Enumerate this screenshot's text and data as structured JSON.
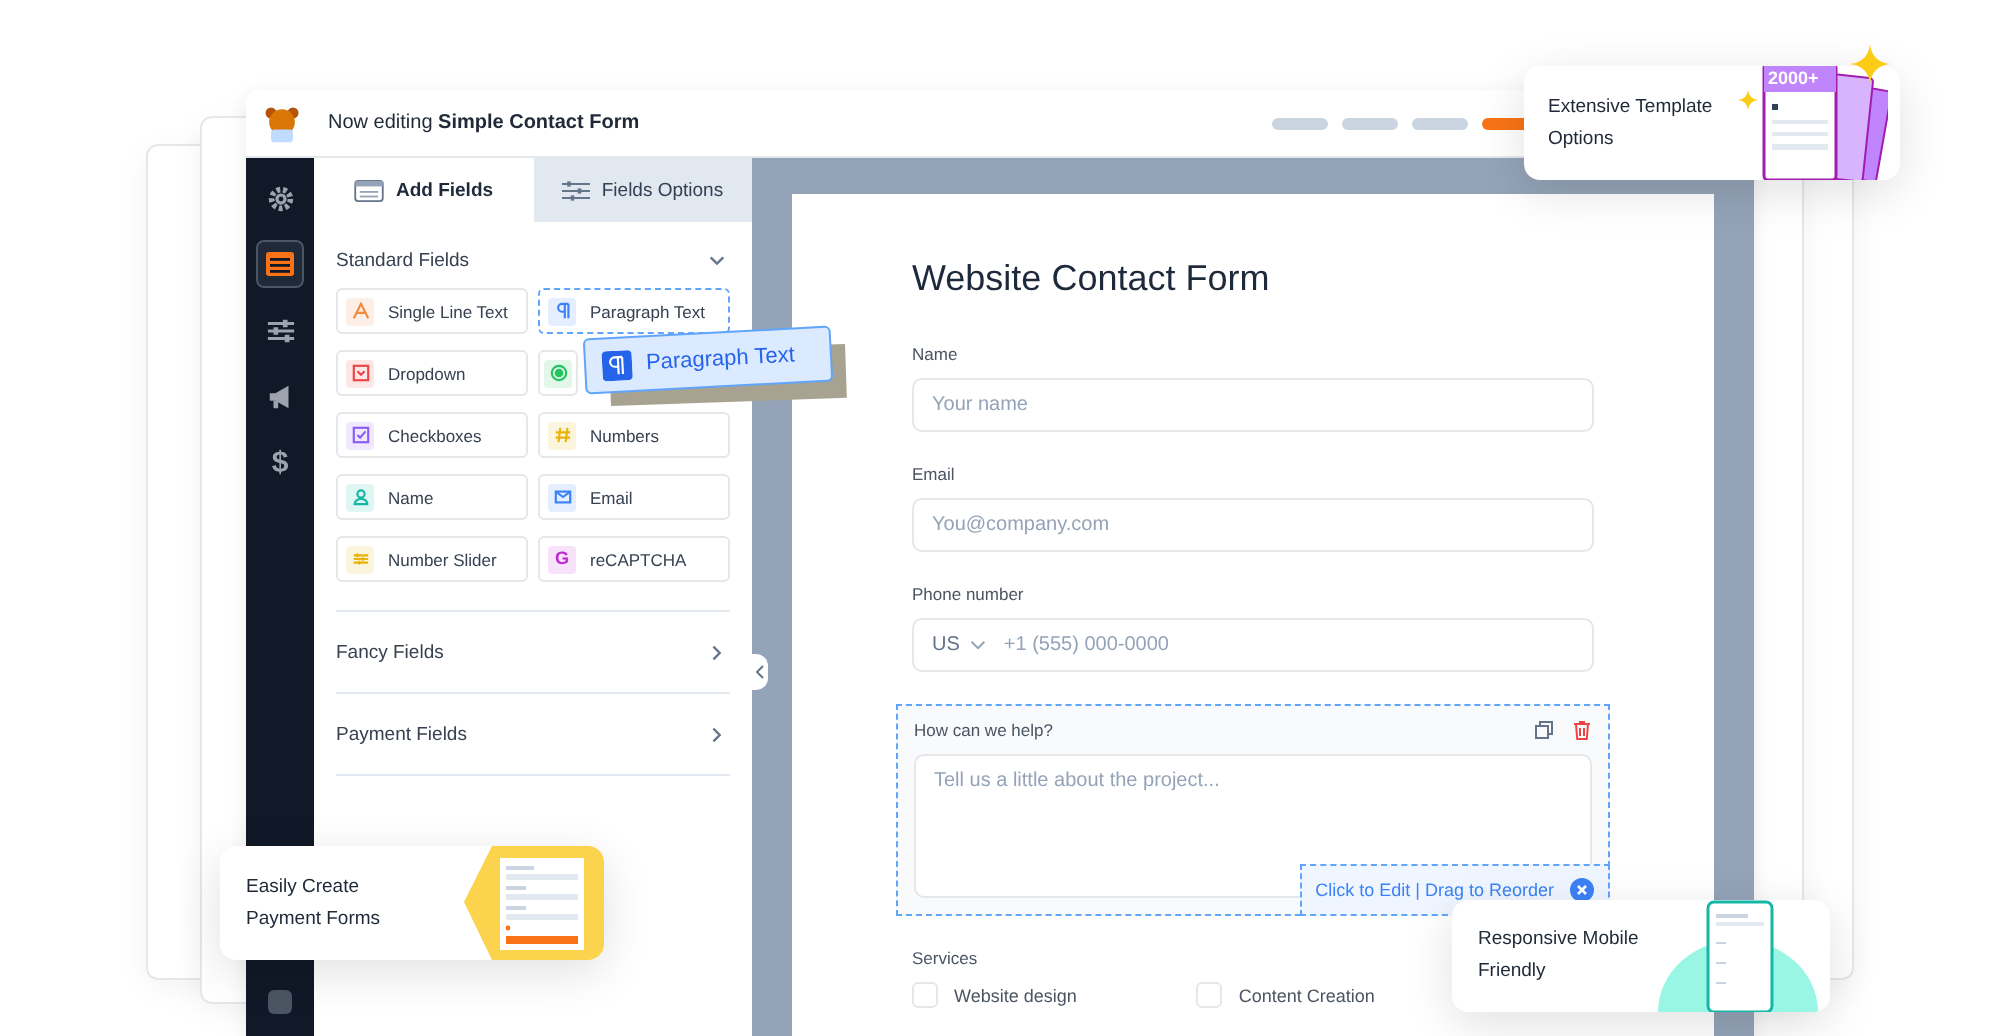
{
  "editor": {
    "title": "Now editing **Simple Contact Form**"
  },
  "sidebar": {
    "items": [
      {
        "kind": "settings",
        "selected": false
      },
      {
        "kind": "fields",
        "selected": true
      },
      {
        "kind": "sliders",
        "selected": false
      },
      {
        "kind": "marketing",
        "selected": false
      },
      {
        "kind": "payments",
        "glyph": "$",
        "selected": false
      }
    ]
  },
  "tabs": [
    {
      "label": "Add Fields",
      "kind": "fields",
      "selected": true
    },
    {
      "label": "Fields Options",
      "kind": "options",
      "selected": false
    }
  ],
  "sections": [
    {
      "title": "Standard Fields",
      "expanded": true,
      "fields": [
        {
          "kind": "text",
          "label": "Single Line Text",
          "color": "#f08a3c",
          "dragging": false
        },
        {
          "kind": "paragraph",
          "label": "Paragraph Text",
          "color": "#3b82f6",
          "dragging": true
        },
        {
          "kind": "dropdown",
          "label": "Dropdown",
          "color": "#ef4444",
          "dragging": false
        },
        {
          "kind": "radio",
          "color": "#22c55e",
          "dragging": false
        },
        {
          "kind": "checkbox",
          "label": "Checkboxes",
          "color": "#8b5cf6",
          "dragging": false
        },
        {
          "kind": "number",
          "label": "Numbers",
          "color": "#eab308",
          "dragging": false
        },
        {
          "kind": "person",
          "label": "Name",
          "color": "#14b8a6",
          "dragging": false
        },
        {
          "kind": "email",
          "label": "Email",
          "color": "#3b82f6",
          "dragging": false
        },
        {
          "kind": "slider",
          "label": "Number Slider",
          "color": "#eab308",
          "dragging": false
        },
        {
          "kind": "captcha",
          "glyph": "G",
          "label": "reCAPTCHA",
          "color": "#c026d3",
          "dragging": false
        }
      ]
    },
    {
      "title": "Fancy Fields",
      "expanded": false
    },
    {
      "title": "Payment Fields",
      "expanded": false
    }
  ],
  "drag_chip": {
    "label": "Paragraph Text"
  },
  "form": {
    "title": "Website Contact Form",
    "fields": [
      {
        "kind": "text",
        "label": "Name",
        "placeholder": "Your name"
      },
      {
        "kind": "text",
        "label": "Email",
        "placeholder": "You@company.com"
      },
      {
        "kind": "phone",
        "label": "Phone number",
        "country": "US",
        "placeholder": "+1 (555) 000-0000"
      },
      {
        "kind": "textarea",
        "label": "How can we help?",
        "placeholder": "Tell us a little about the project...",
        "selected": true,
        "hint": "Click to Edit | Drag to Reorder"
      },
      {
        "kind": "checkboxes",
        "label": "Services",
        "options": [
          {
            "label": "Website design",
            "checked": false
          },
          {
            "label": "Content Creation",
            "checked": false
          }
        ]
      }
    ]
  },
  "callouts": [
    {
      "kind": "templates",
      "text": "Extensive Template Options",
      "badge": "2000+"
    },
    {
      "kind": "payments",
      "text": "Easily Create Payment Forms"
    },
    {
      "kind": "mobile",
      "text": "Responsive Mobile Friendly"
    }
  ]
}
